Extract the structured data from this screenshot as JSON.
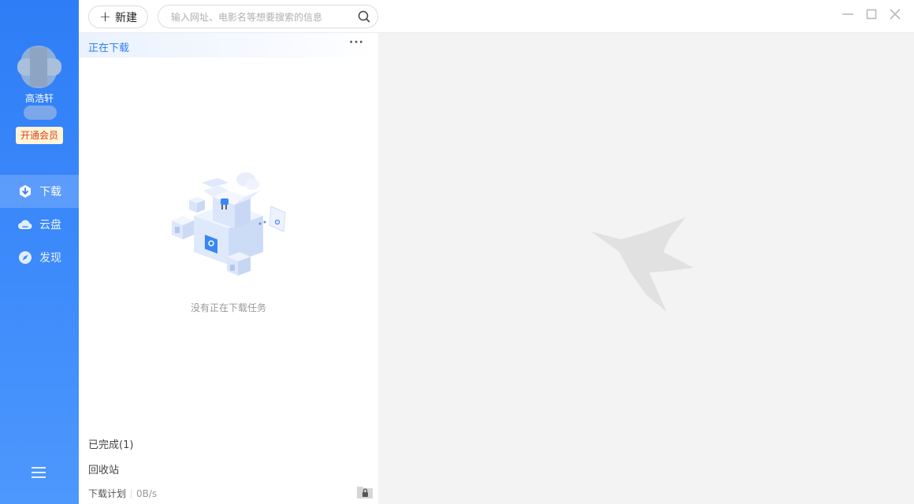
{
  "sidebar": {
    "username": "高浩轩",
    "vip_label": "开通会员",
    "nav": [
      {
        "label": "下载",
        "icon": "download-icon",
        "active": true
      },
      {
        "label": "云盘",
        "icon": "cloud-icon",
        "active": false
      },
      {
        "label": "发现",
        "icon": "compass-icon",
        "active": false
      }
    ]
  },
  "toolbar": {
    "new_label": "新建",
    "search_placeholder": "输入网址、电影名等想要搜索的信息"
  },
  "downloads": {
    "section_title": "正在下载",
    "more_label": "···",
    "empty_text": "没有正在下载任务",
    "completed_label": "已完成(1)",
    "recycle_label": "回收站",
    "schedule_label": "下载计划",
    "speed": "0B/s"
  },
  "colors": {
    "accent": "#2f7df6",
    "vip_text": "#d6461b",
    "vip_bg": "#fff4d8",
    "detail_bg": "#f3f3f3"
  }
}
